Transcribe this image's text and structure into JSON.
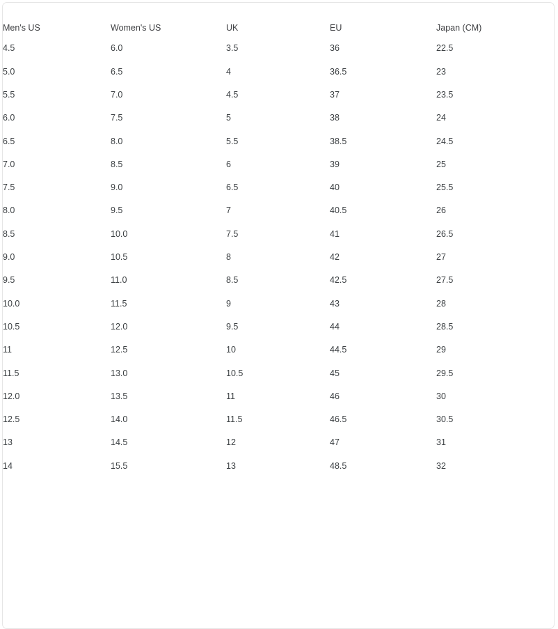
{
  "table": {
    "columns": [
      {
        "key": "mens",
        "label": "Men's US"
      },
      {
        "key": "womens",
        "label": "Women's US"
      },
      {
        "key": "uk",
        "label": "UK"
      },
      {
        "key": "eu",
        "label": "EU"
      },
      {
        "key": "japan",
        "label": "Japan (CM)"
      }
    ],
    "rows": [
      {
        "mens": "4.5",
        "womens": "6.0",
        "uk": "3.5",
        "eu": "36",
        "japan": "22.5"
      },
      {
        "mens": "5.0",
        "womens": "6.5",
        "uk": "4",
        "eu": "36.5",
        "japan": "23"
      },
      {
        "mens": "5.5",
        "womens": "7.0",
        "uk": "4.5",
        "eu": "37",
        "japan": "23.5"
      },
      {
        "mens": "6.0",
        "womens": "7.5",
        "uk": "5",
        "eu": "38",
        "japan": "24"
      },
      {
        "mens": "6.5",
        "womens": "8.0",
        "uk": "5.5",
        "eu": "38.5",
        "japan": "24.5"
      },
      {
        "mens": "7.0",
        "womens": "8.5",
        "uk": "6",
        "eu": "39",
        "japan": "25"
      },
      {
        "mens": "7.5",
        "womens": "9.0",
        "uk": "6.5",
        "eu": "40",
        "japan": "25.5"
      },
      {
        "mens": "8.0",
        "womens": "9.5",
        "uk": "7",
        "eu": "40.5",
        "japan": "26"
      },
      {
        "mens": "8.5",
        "womens": "10.0",
        "uk": "7.5",
        "eu": "41",
        "japan": "26.5"
      },
      {
        "mens": "9.0",
        "womens": "10.5",
        "uk": "8",
        "eu": "42",
        "japan": "27"
      },
      {
        "mens": "9.5",
        "womens": "11.0",
        "uk": "8.5",
        "eu": "42.5",
        "japan": "27.5"
      },
      {
        "mens": "10.0",
        "womens": "11.5",
        "uk": "9",
        "eu": "43",
        "japan": "28"
      },
      {
        "mens": "10.5",
        "womens": "12.0",
        "uk": "9.5",
        "eu": "44",
        "japan": "28.5"
      },
      {
        "mens": "11",
        "womens": "12.5",
        "uk": "10",
        "eu": "44.5",
        "japan": "29"
      },
      {
        "mens": "11.5",
        "womens": "13.0",
        "uk": "10.5",
        "eu": "45",
        "japan": "29.5"
      },
      {
        "mens": "12.0",
        "womens": "13.5",
        "uk": "11",
        "eu": "46",
        "japan": "30"
      },
      {
        "mens": "12.5",
        "womens": "14.0",
        "uk": "11.5",
        "eu": "46.5",
        "japan": "30.5"
      },
      {
        "mens": "13",
        "womens": "14.5",
        "uk": "12",
        "eu": "47",
        "japan": "31"
      },
      {
        "mens": "14",
        "womens": "15.5",
        "uk": "13",
        "eu": "48.5",
        "japan": "32"
      }
    ]
  },
  "colors": {
    "text": "#3c4043",
    "header_text": "#3f4043",
    "border": "#e6e6e6",
    "background": "#ffffff"
  }
}
